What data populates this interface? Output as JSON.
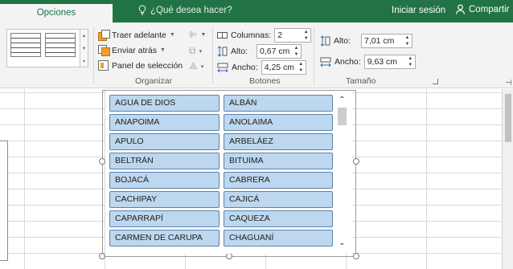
{
  "ribbon_tab": {
    "label": "Opciones"
  },
  "tell_me": {
    "text": "¿Qué desea hacer?"
  },
  "account": {
    "signin": "Iniciar sesión",
    "share": "Compartir"
  },
  "organizar": {
    "bring_forward": "Traer adelante",
    "send_backward": "Enviar atrás",
    "selection_pane": "Panel de selección",
    "label": "Organizar"
  },
  "botones": {
    "columns_label": "Columnas:",
    "columns_value": "2",
    "height_label": "Alto:",
    "height_value": "0,67 cm",
    "width_label": "Ancho:",
    "width_value": "4,25 cm",
    "label": "Botones"
  },
  "tamano": {
    "height_label": "Alto:",
    "height_value": "7,01 cm",
    "width_label": "Ancho:",
    "width_value": "9,63 cm",
    "label": "Tamaño"
  },
  "slicer_items": [
    "AGUA DE DIOS",
    "ALBÁN",
    "ANAPOIMA",
    "ANOLAIMA",
    "APULO",
    "ARBELÁEZ",
    "BELTRÁN",
    "BITUIMA",
    "BOJACÁ",
    "CABRERA",
    "CACHIPAY",
    "CAJICÁ",
    "CAPARRAPÍ",
    "CAQUEZA",
    "CARMEN DE CARUPA",
    "CHAGUANÍ"
  ],
  "colors": {
    "accent": "#217346",
    "item_fill": "#bdd7ee",
    "item_border": "#5b82b0"
  },
  "icons": {
    "tell_me": "lightbulb-icon",
    "share": "person-icon",
    "columns": "columns-icon",
    "height": "height-icon",
    "width": "width-icon"
  }
}
